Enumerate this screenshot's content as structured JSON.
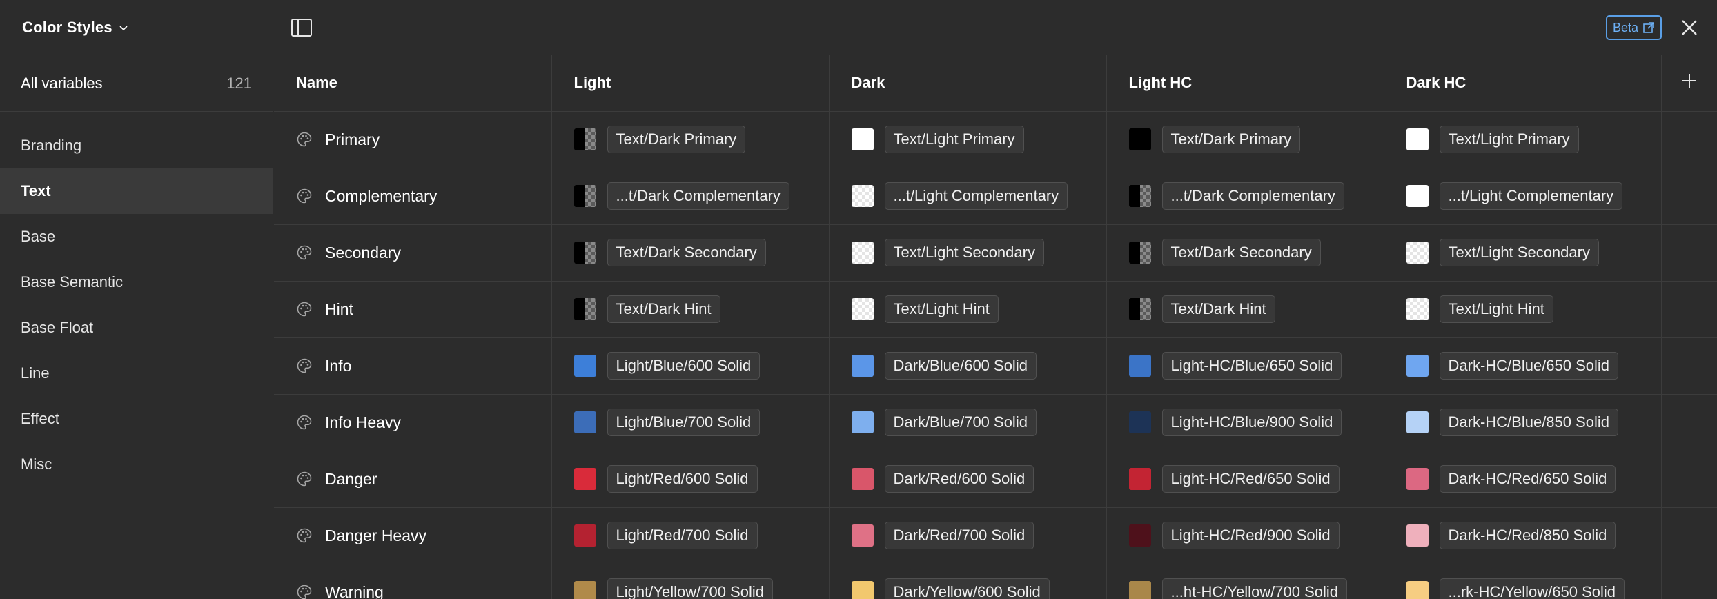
{
  "sidebar": {
    "title": "Color Styles",
    "all_label": "All variables",
    "all_count": "121",
    "items": [
      {
        "label": "Branding"
      },
      {
        "label": "Text"
      },
      {
        "label": "Base"
      },
      {
        "label": "Base Semantic"
      },
      {
        "label": "Base Float"
      },
      {
        "label": "Line"
      },
      {
        "label": "Effect"
      },
      {
        "label": "Misc"
      }
    ],
    "active_index": 1
  },
  "topbar": {
    "beta_label": "Beta"
  },
  "table": {
    "headers": [
      "Name",
      "Light",
      "Dark",
      "Light HC",
      "Dark HC"
    ],
    "rows": [
      {
        "name": "Primary",
        "values": [
          {
            "text": "Text/Dark Primary",
            "swatch": "#000000",
            "pattern": "half"
          },
          {
            "text": "Text/Light Primary",
            "swatch": "#ffffff",
            "pattern": "solid"
          },
          {
            "text": "Text/Dark Primary",
            "swatch": "#000000",
            "pattern": "solid"
          },
          {
            "text": "Text/Light Primary",
            "swatch": "#ffffff",
            "pattern": "solid"
          }
        ]
      },
      {
        "name": "Complementary",
        "values": [
          {
            "text": "...t/Dark Complementary",
            "swatch": "#000000",
            "pattern": "half"
          },
          {
            "text": "...t/Light Complementary",
            "swatch": "#ffffff",
            "pattern": "checker"
          },
          {
            "text": "...t/Dark Complementary",
            "swatch": "#000000",
            "pattern": "half"
          },
          {
            "text": "...t/Light Complementary",
            "swatch": "#ffffff",
            "pattern": "solid"
          }
        ]
      },
      {
        "name": "Secondary",
        "values": [
          {
            "text": "Text/Dark Secondary",
            "swatch": "#000000",
            "pattern": "half"
          },
          {
            "text": "Text/Light Secondary",
            "swatch": "#ffffff",
            "pattern": "checker"
          },
          {
            "text": "Text/Dark Secondary",
            "swatch": "#000000",
            "pattern": "half"
          },
          {
            "text": "Text/Light Secondary",
            "swatch": "#ffffff",
            "pattern": "checker"
          }
        ]
      },
      {
        "name": "Hint",
        "values": [
          {
            "text": "Text/Dark Hint",
            "swatch": "#000000",
            "pattern": "half"
          },
          {
            "text": "Text/Light Hint",
            "swatch": "#ffffff",
            "pattern": "checker"
          },
          {
            "text": "Text/Dark Hint",
            "swatch": "#000000",
            "pattern": "half"
          },
          {
            "text": "Text/Light Hint",
            "swatch": "#ffffff",
            "pattern": "checker"
          }
        ]
      },
      {
        "name": "Info",
        "values": [
          {
            "text": "Light/Blue/600 Solid",
            "swatch": "#3d7fd9",
            "pattern": "solid"
          },
          {
            "text": "Dark/Blue/600 Solid",
            "swatch": "#5b96e8",
            "pattern": "solid"
          },
          {
            "text": "Light-HC/Blue/650 Solid",
            "swatch": "#3b74c7",
            "pattern": "solid"
          },
          {
            "text": "Dark-HC/Blue/650 Solid",
            "swatch": "#6fa6f0",
            "pattern": "solid"
          }
        ]
      },
      {
        "name": "Info Heavy",
        "values": [
          {
            "text": "Light/Blue/700 Solid",
            "swatch": "#3c6db8",
            "pattern": "solid"
          },
          {
            "text": "Dark/Blue/700 Solid",
            "swatch": "#7eafee",
            "pattern": "solid"
          },
          {
            "text": "Light-HC/Blue/900 Solid",
            "swatch": "#1d3356",
            "pattern": "solid"
          },
          {
            "text": "Dark-HC/Blue/850 Solid",
            "swatch": "#b5d2f6",
            "pattern": "solid"
          }
        ]
      },
      {
        "name": "Danger",
        "values": [
          {
            "text": "Light/Red/600 Solid",
            "swatch": "#d92b3a",
            "pattern": "solid"
          },
          {
            "text": "Dark/Red/600 Solid",
            "swatch": "#d9566a",
            "pattern": "solid"
          },
          {
            "text": "Light-HC/Red/650 Solid",
            "swatch": "#c32433",
            "pattern": "solid"
          },
          {
            "text": "Dark-HC/Red/650 Solid",
            "swatch": "#dc6882",
            "pattern": "solid"
          }
        ]
      },
      {
        "name": "Danger Heavy",
        "values": [
          {
            "text": "Light/Red/700 Solid",
            "swatch": "#b42231",
            "pattern": "solid"
          },
          {
            "text": "Dark/Red/700 Solid",
            "swatch": "#df7186",
            "pattern": "solid"
          },
          {
            "text": "Light-HC/Red/900 Solid",
            "swatch": "#4e111b",
            "pattern": "solid"
          },
          {
            "text": "Dark-HC/Red/850 Solid",
            "swatch": "#efb0bc",
            "pattern": "solid"
          }
        ]
      },
      {
        "name": "Warning",
        "values": [
          {
            "text": "Light/Yellow/700 Solid",
            "swatch": "#b08a4a",
            "pattern": "solid"
          },
          {
            "text": "Dark/Yellow/600 Solid",
            "swatch": "#f2c86e",
            "pattern": "solid"
          },
          {
            "text": "...ht-HC/Yellow/700 Solid",
            "swatch": "#a9874a",
            "pattern": "solid"
          },
          {
            "text": "...rk-HC/Yellow/650 Solid",
            "swatch": "#f6cd82",
            "pattern": "solid"
          }
        ]
      }
    ]
  }
}
